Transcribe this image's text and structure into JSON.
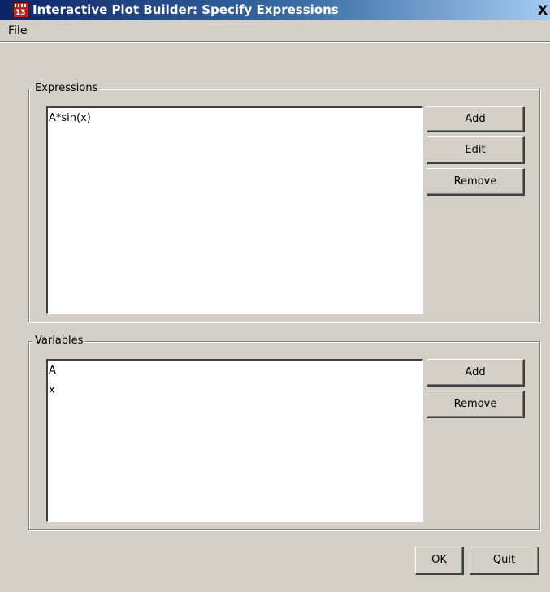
{
  "window": {
    "title": "Interactive Plot Builder: Specify Expressions",
    "app_icon_text": "13",
    "close_glyph": "X",
    "icon_name": "maple-app-icon"
  },
  "menu": {
    "file_label": "File"
  },
  "expressions": {
    "group_label": "Expressions",
    "items": [
      "A*sin(x)"
    ],
    "buttons": {
      "add": "Add",
      "edit": "Edit",
      "remove": "Remove"
    }
  },
  "variables": {
    "group_label": "Variables",
    "items": [
      "A",
      "x"
    ],
    "buttons": {
      "add": "Add",
      "remove": "Remove"
    }
  },
  "footer": {
    "ok_label": "OK",
    "quit_label": "Quit"
  },
  "colors": {
    "window_face": "#d4d0c8",
    "titlebar_start": "#0a246a",
    "titlebar_end": "#a6caf0",
    "list_background": "#ffffff"
  }
}
